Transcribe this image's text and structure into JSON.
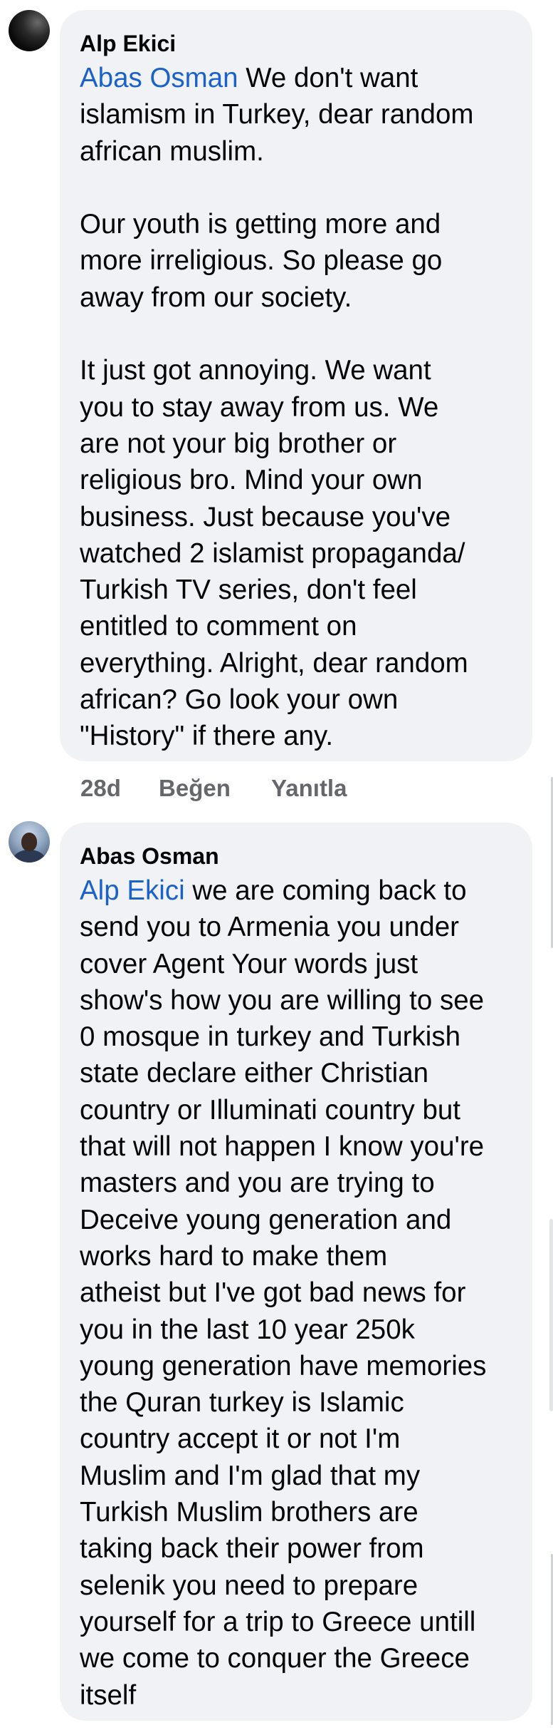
{
  "comments": [
    {
      "author": "Alp Ekici",
      "mention": "Abas Osman",
      "lines": [
        " We don't want",
        "islamism in Turkey,  dear random",
        "african muslim.",
        "",
        "Our youth is getting more and",
        "more irreligious. So please go",
        "away from our society.",
        "",
        "It just got annoying.  We want",
        "you to stay away from us.  We",
        "are not your big brother or",
        "religious bro.  Mind your own",
        "business.  Just because you've",
        "watched 2 islamist propaganda/",
        "Turkish TV series, don't feel",
        "entitled to comment on",
        "everything. Alright, dear random",
        "african? Go look your own",
        "\"History\" if there any."
      ],
      "time": "28d",
      "like_label": "Beğen",
      "reply_label": "Yanıtla"
    },
    {
      "author": "Abas Osman",
      "mention": "Alp Ekici",
      "lines": [
        "  we are coming back to",
        "send you to Armenia you under",
        "cover Agent Your words just",
        "show's how you are willing to see",
        "0 mosque in turkey  and Turkish",
        "state declare either Christian",
        "country or  Illuminati country but",
        "that will not happen I know you're",
        "masters and you are trying to",
        "Deceive young generation and",
        "works hard to make them",
        "atheist but I've got bad news for",
        "you in the last 10 year 250k",
        "young generation have memories",
        "the Quran turkey is Islamic",
        "country  accept it or not  I'm",
        "Muslim and I'm glad that my",
        "Turkish Muslim brothers are",
        "taking back their power from",
        "selenik you need to prepare",
        "yourself for a trip to Greece untill",
        "we come to conquer the Greece",
        "itself"
      ]
    }
  ]
}
